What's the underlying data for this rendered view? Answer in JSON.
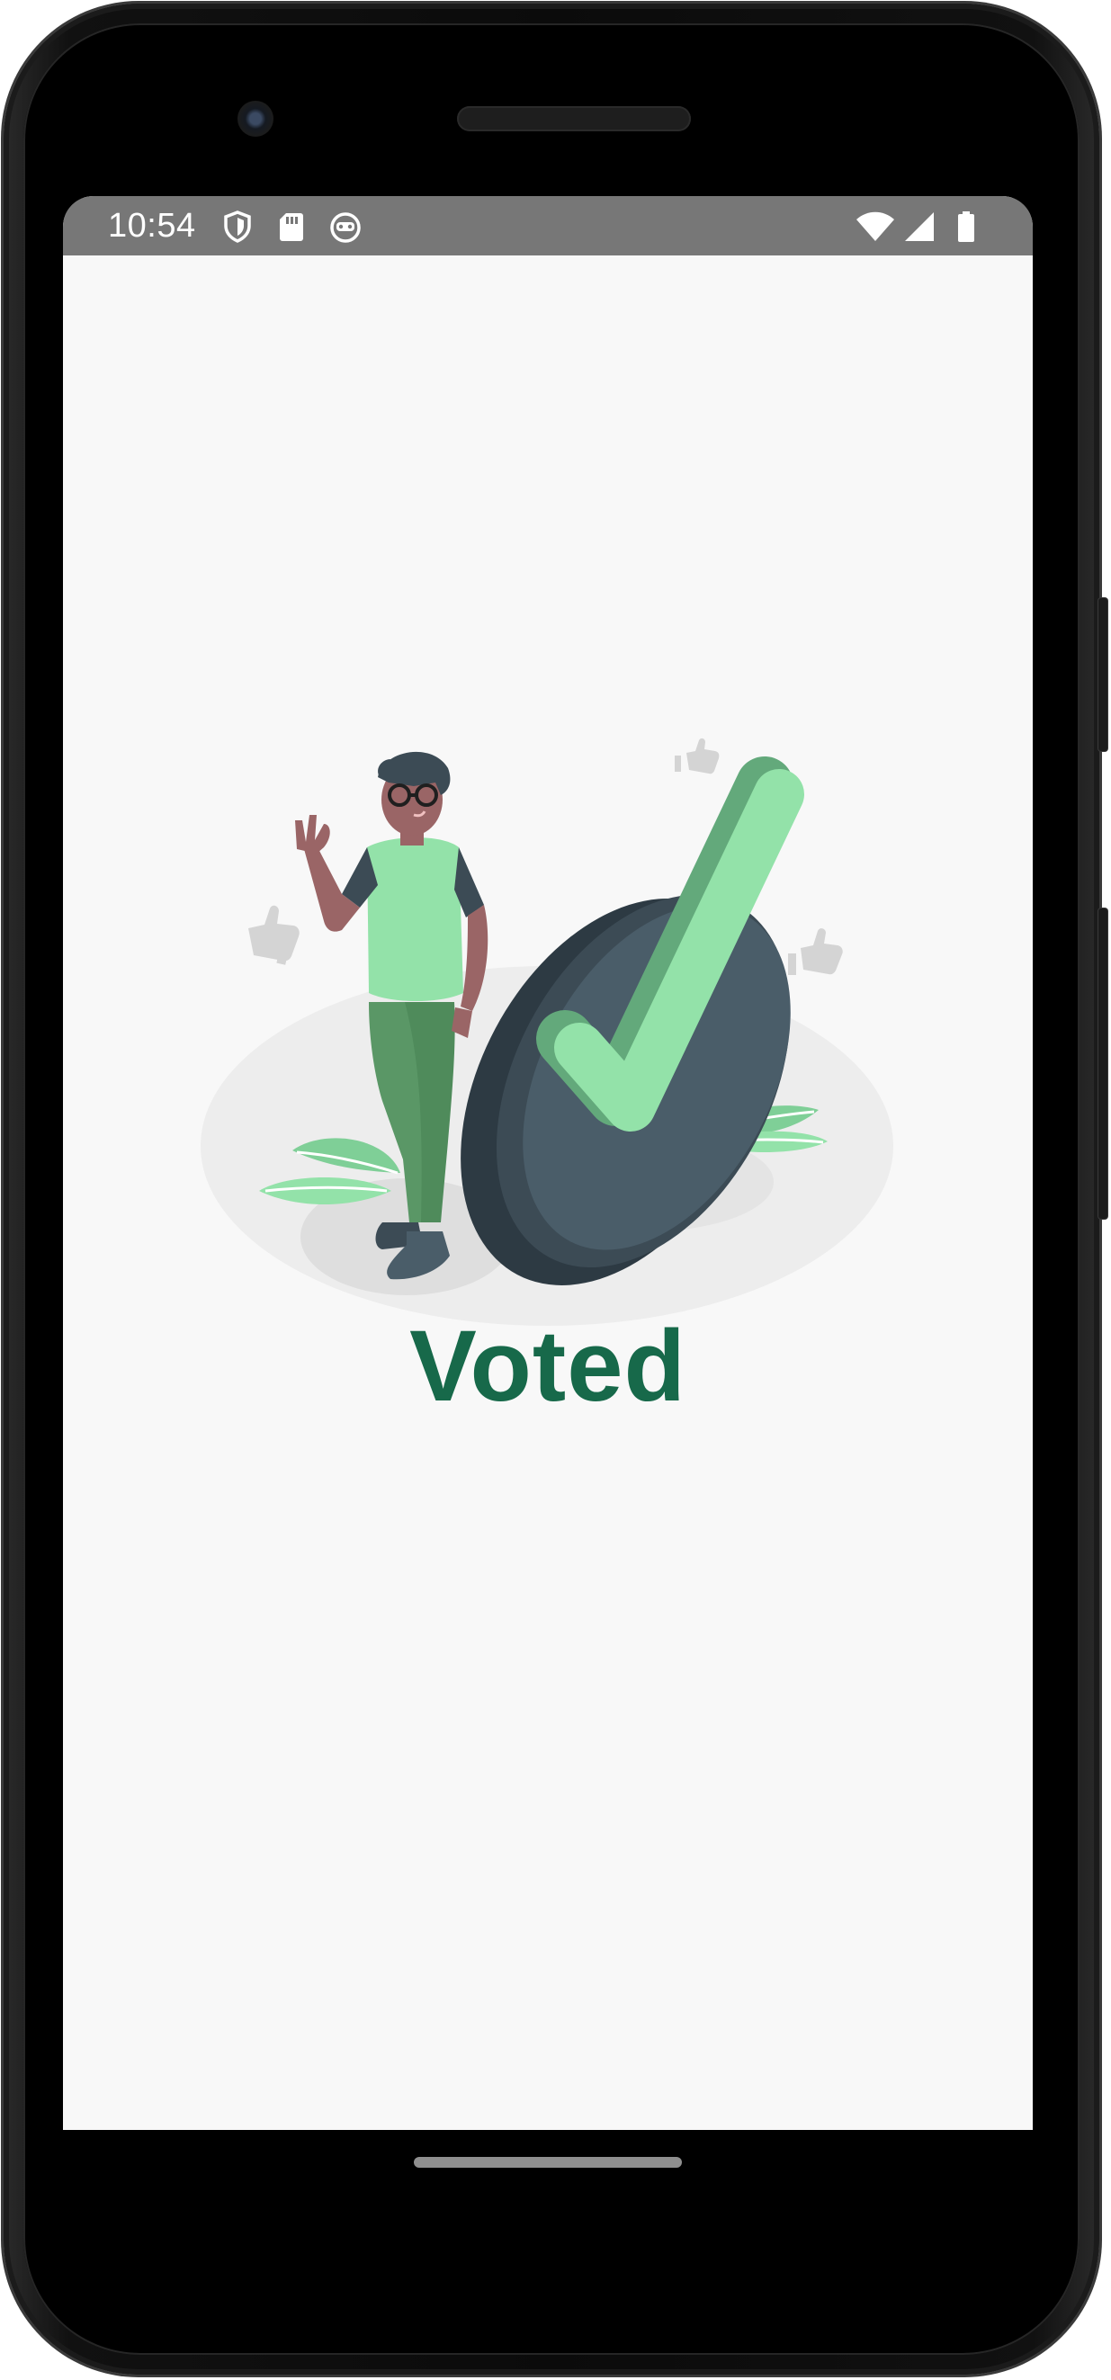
{
  "status_bar": {
    "time": "10:54",
    "left_icons": [
      "shield-icon",
      "sd-card-icon",
      "robot-face-icon"
    ],
    "right_icons": [
      "wifi-icon",
      "cellular-signal-icon",
      "battery-icon"
    ],
    "background": "#777777"
  },
  "main": {
    "illustration": "person-with-green-checkmark-illustration",
    "title": "Voted",
    "title_color": "#17694a"
  },
  "navigation": {
    "home_indicator": "home-indicator"
  }
}
